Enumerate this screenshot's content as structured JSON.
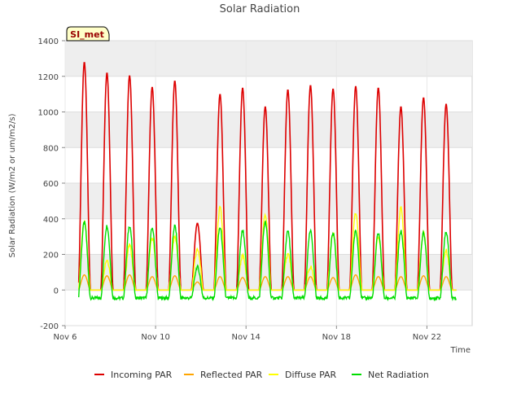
{
  "chart_data": {
    "type": "line",
    "title": "Solar Radiation",
    "xlabel": "Time",
    "ylabel": "Solar Radiation (W/m2 or um/m2/s)",
    "site_label": "SI_met",
    "xlim": [
      6.0,
      24.0
    ],
    "ylim": [
      -200,
      1400
    ],
    "yticks": [
      -200,
      0,
      200,
      400,
      600,
      800,
      1000,
      1200,
      1400
    ],
    "xticks": [
      {
        "value": 6,
        "label": "Nov 6"
      },
      {
        "value": 10,
        "label": "Nov 10"
      },
      {
        "value": 14,
        "label": "Nov 14"
      },
      {
        "value": 18,
        "label": "Nov 18"
      },
      {
        "value": 22,
        "label": "Nov 22"
      }
    ],
    "grid": true,
    "legend_position": "bottom",
    "series": [
      {
        "name": "Incoming PAR",
        "color": "#dd0000",
        "peaks": [
          1280,
          1220,
          1205,
          1140,
          1175,
          375,
          1100,
          1135,
          1030,
          1125,
          1150,
          1130,
          1145,
          1135,
          1030,
          1080,
          1045
        ]
      },
      {
        "name": "Reflected PAR",
        "color": "#ffa500",
        "peaks": [
          85,
          80,
          85,
          75,
          80,
          45,
          75,
          70,
          75,
          75,
          75,
          70,
          85,
          75,
          75,
          80,
          75
        ]
      },
      {
        "name": "Diffuse PAR",
        "color": "#ffff00",
        "peaks": [
          385,
          170,
          250,
          290,
          300,
          230,
          460,
          190,
          420,
          200,
          130,
          320,
          440,
          300,
          460,
          320,
          220
        ]
      },
      {
        "name": "Net Radiation",
        "color": "#00dd00",
        "peaks": [
          380,
          360,
          360,
          350,
          360,
          130,
          350,
          335,
          380,
          330,
          330,
          320,
          330,
          320,
          330,
          320,
          325
        ],
        "night_value": -45
      }
    ],
    "day_centers": [
      6.85,
      7.85,
      8.85,
      9.85,
      10.85,
      11.85,
      12.85,
      13.85,
      14.85,
      15.85,
      16.85,
      17.85,
      18.85,
      19.85,
      20.85,
      21.85,
      22.85
    ]
  }
}
